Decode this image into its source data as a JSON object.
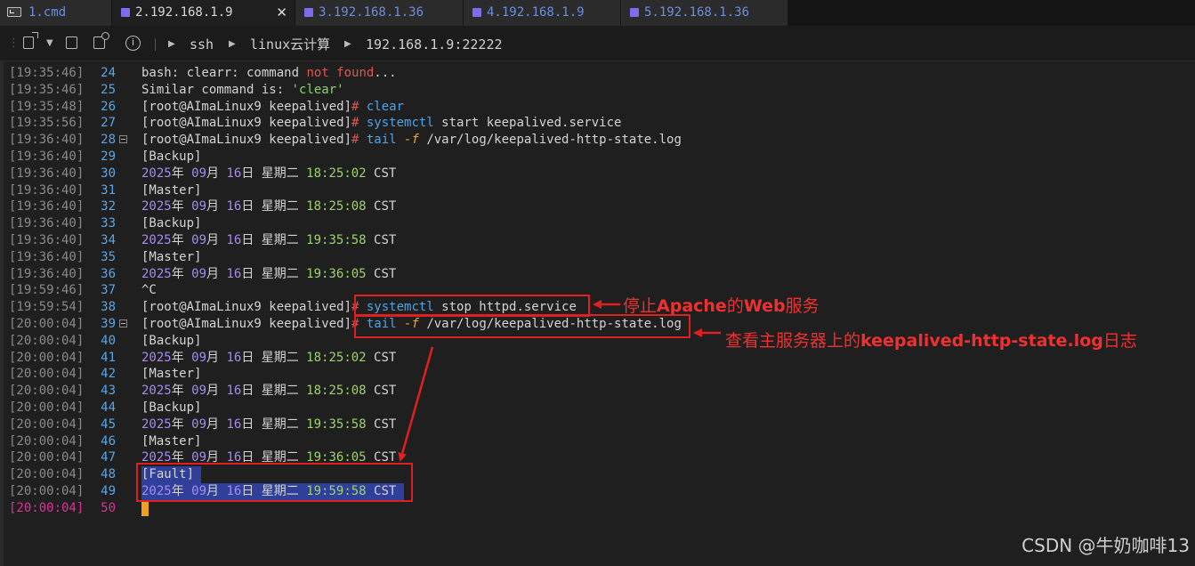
{
  "tabs": [
    {
      "label": "1.cmd",
      "icon": "cmd-icon",
      "active": false
    },
    {
      "label": "2.192.168.1.9",
      "icon": "session-icon",
      "active": true,
      "close": "✕"
    },
    {
      "label": "3.192.168.1.36",
      "icon": "session-icon",
      "active": false
    },
    {
      "label": "4.192.168.1.9",
      "icon": "session-icon",
      "active": false
    },
    {
      "label": "5.192.168.1.36",
      "icon": "session-icon",
      "active": false
    }
  ],
  "toolbar": {
    "info": "i",
    "breadcrumb": [
      "ssh",
      "linux云计算",
      "192.168.1.9:22222"
    ]
  },
  "lines": [
    {
      "ts": "[19:35:46]",
      "n": "24",
      "segs": [
        [
          "bash: clearr: command ",
          "w"
        ],
        [
          "not found",
          "red"
        ],
        [
          "...",
          "w"
        ]
      ]
    },
    {
      "ts": "[19:35:46]",
      "n": "25",
      "segs": [
        [
          "Similar command is: ",
          "w"
        ],
        [
          "'clear'",
          "str"
        ]
      ]
    },
    {
      "ts": "[19:35:48]",
      "n": "26",
      "segs": [
        [
          "[root@AImaLinux9 keepalived]",
          "w"
        ],
        [
          "# ",
          "red"
        ],
        [
          "clear",
          "cmd"
        ]
      ]
    },
    {
      "ts": "[19:35:56]",
      "n": "27",
      "segs": [
        [
          "[root@AImaLinux9 keepalived]",
          "w"
        ],
        [
          "# ",
          "red"
        ],
        [
          "systemctl",
          "cmd"
        ],
        [
          " start keepalived.service",
          "w"
        ]
      ]
    },
    {
      "ts": "[19:36:40]",
      "n": "28",
      "fold": true,
      "segs": [
        [
          "[root@AImaLinux9 keepalived]",
          "w"
        ],
        [
          "# ",
          "red"
        ],
        [
          "tail",
          "cmd"
        ],
        [
          " ",
          "w"
        ],
        [
          "-f",
          "flag"
        ],
        [
          " /var/log/keepalived-http-state.log",
          "w"
        ]
      ]
    },
    {
      "ts": "[19:36:40]",
      "n": "29",
      "segs": [
        [
          "[Backup]",
          "w"
        ]
      ]
    },
    {
      "ts": "[19:36:40]",
      "n": "30",
      "segs": [
        [
          "2025",
          "y"
        ],
        [
          "年 ",
          "w"
        ],
        [
          "09",
          "y"
        ],
        [
          "月 ",
          "w"
        ],
        [
          "16",
          "y"
        ],
        [
          "日 星期二 ",
          "w"
        ],
        [
          "18:25:02",
          "t"
        ],
        [
          " CST",
          "w"
        ]
      ]
    },
    {
      "ts": "[19:36:40]",
      "n": "31",
      "segs": [
        [
          "[Master]",
          "w"
        ]
      ]
    },
    {
      "ts": "[19:36:40]",
      "n": "32",
      "segs": [
        [
          "2025",
          "y"
        ],
        [
          "年 ",
          "w"
        ],
        [
          "09",
          "y"
        ],
        [
          "月 ",
          "w"
        ],
        [
          "16",
          "y"
        ],
        [
          "日 星期二 ",
          "w"
        ],
        [
          "18:25:08",
          "t"
        ],
        [
          " CST",
          "w"
        ]
      ]
    },
    {
      "ts": "[19:36:40]",
      "n": "33",
      "segs": [
        [
          "[Backup]",
          "w"
        ]
      ]
    },
    {
      "ts": "[19:36:40]",
      "n": "34",
      "segs": [
        [
          "2025",
          "y"
        ],
        [
          "年 ",
          "w"
        ],
        [
          "09",
          "y"
        ],
        [
          "月 ",
          "w"
        ],
        [
          "16",
          "y"
        ],
        [
          "日 星期二 ",
          "w"
        ],
        [
          "19:35:58",
          "t"
        ],
        [
          " CST",
          "w"
        ]
      ]
    },
    {
      "ts": "[19:36:40]",
      "n": "35",
      "segs": [
        [
          "[Master]",
          "w"
        ]
      ]
    },
    {
      "ts": "[19:36:40]",
      "n": "36",
      "segs": [
        [
          "2025",
          "y"
        ],
        [
          "年 ",
          "w"
        ],
        [
          "09",
          "y"
        ],
        [
          "月 ",
          "w"
        ],
        [
          "16",
          "y"
        ],
        [
          "日 星期二 ",
          "w"
        ],
        [
          "19:36:05",
          "t"
        ],
        [
          " CST",
          "w"
        ]
      ]
    },
    {
      "ts": "[19:59:46]",
      "n": "37",
      "segs": [
        [
          "^C",
          "w"
        ]
      ]
    },
    {
      "ts": "[19:59:54]",
      "n": "38",
      "segs": [
        [
          "[root@AImaLinux9 keepalived]",
          "w"
        ],
        [
          "# ",
          "red"
        ],
        [
          "systemctl",
          "cmd"
        ],
        [
          " stop httpd.service",
          "w"
        ]
      ]
    },
    {
      "ts": "[20:00:04]",
      "n": "39",
      "fold": true,
      "segs": [
        [
          "[root@AImaLinux9 keepalived]",
          "w"
        ],
        [
          "# ",
          "red"
        ],
        [
          "tail",
          "cmd"
        ],
        [
          " ",
          "w"
        ],
        [
          "-f",
          "flag"
        ],
        [
          " /var/log/keepalived-http-state.log",
          "w"
        ]
      ]
    },
    {
      "ts": "[20:00:04]",
      "n": "40",
      "segs": [
        [
          "[Backup]",
          "w"
        ]
      ]
    },
    {
      "ts": "[20:00:04]",
      "n": "41",
      "segs": [
        [
          "2025",
          "y"
        ],
        [
          "年 ",
          "w"
        ],
        [
          "09",
          "y"
        ],
        [
          "月 ",
          "w"
        ],
        [
          "16",
          "y"
        ],
        [
          "日 星期二 ",
          "w"
        ],
        [
          "18:25:02",
          "t"
        ],
        [
          " CST",
          "w"
        ]
      ]
    },
    {
      "ts": "[20:00:04]",
      "n": "42",
      "segs": [
        [
          "[Master]",
          "w"
        ]
      ]
    },
    {
      "ts": "[20:00:04]",
      "n": "43",
      "segs": [
        [
          "2025",
          "y"
        ],
        [
          "年 ",
          "w"
        ],
        [
          "09",
          "y"
        ],
        [
          "月 ",
          "w"
        ],
        [
          "16",
          "y"
        ],
        [
          "日 星期二 ",
          "w"
        ],
        [
          "18:25:08",
          "t"
        ],
        [
          " CST",
          "w"
        ]
      ]
    },
    {
      "ts": "[20:00:04]",
      "n": "44",
      "segs": [
        [
          "[Backup]",
          "w"
        ]
      ]
    },
    {
      "ts": "[20:00:04]",
      "n": "45",
      "segs": [
        [
          "2025",
          "y"
        ],
        [
          "年 ",
          "w"
        ],
        [
          "09",
          "y"
        ],
        [
          "月 ",
          "w"
        ],
        [
          "16",
          "y"
        ],
        [
          "日 星期二 ",
          "w"
        ],
        [
          "19:35:58",
          "t"
        ],
        [
          " CST",
          "w"
        ]
      ]
    },
    {
      "ts": "[20:00:04]",
      "n": "46",
      "segs": [
        [
          "[Master]",
          "w"
        ]
      ]
    },
    {
      "ts": "[20:00:04]",
      "n": "47",
      "segs": [
        [
          "2025",
          "y"
        ],
        [
          "年 ",
          "w"
        ],
        [
          "09",
          "y"
        ],
        [
          "月 ",
          "w"
        ],
        [
          "16",
          "y"
        ],
        [
          "日 星期二 ",
          "w"
        ],
        [
          "19:36:05",
          "t"
        ],
        [
          " CST",
          "w"
        ]
      ]
    },
    {
      "ts": "[20:00:04]",
      "n": "48",
      "sel": true,
      "segs": [
        [
          "[Fault] ",
          "w"
        ]
      ]
    },
    {
      "ts": "[20:00:04]",
      "n": "49",
      "sel": true,
      "segs": [
        [
          "2025",
          "y"
        ],
        [
          "年 ",
          "w"
        ],
        [
          "09",
          "y"
        ],
        [
          "月 ",
          "w"
        ],
        [
          "16",
          "y"
        ],
        [
          "日 星期二 ",
          "w"
        ],
        [
          "19:59:58",
          "t"
        ],
        [
          " CST ",
          "w"
        ]
      ]
    },
    {
      "ts": "[20:00:04]",
      "n": "50",
      "current": true,
      "segs": []
    }
  ],
  "annotations": {
    "stop_note_pre": "停止",
    "stop_note_b1": "Apache",
    "stop_note_mid": "的",
    "stop_note_b2": "Web",
    "stop_note_post": "服务",
    "tail_note_pre": "查看主服务器上的",
    "tail_note_b": "keepalived-http-state.log",
    "tail_note_post": "日志"
  },
  "watermark": "CSDN @牛奶咖啡13",
  "colors": {
    "accent_red": "#e02020",
    "selection": "#2f3f9a",
    "cursor": "#f0a020"
  }
}
